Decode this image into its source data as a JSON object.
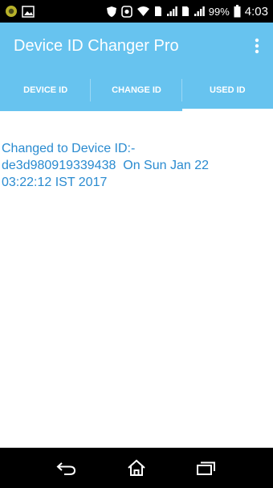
{
  "status_bar": {
    "battery_percent": "99%",
    "time": "4:03",
    "icons_left": [
      "app-icon",
      "gallery-icon"
    ],
    "icons_right": [
      "shield-icon",
      "recorder-icon",
      "wifi-icon",
      "sim-icon",
      "signal-icon",
      "sim-icon",
      "signal-icon",
      "battery-icon"
    ]
  },
  "app_bar": {
    "title": "Device ID Changer Pro",
    "menu_icon": "overflow-menu-icon",
    "background": "#67c3ef"
  },
  "tabs": [
    {
      "label": "DEVICE ID",
      "selected": false
    },
    {
      "label": "CHANGE ID",
      "selected": false
    },
    {
      "label": "USED ID",
      "selected": true
    }
  ],
  "content": {
    "log_entry": "Changed to Device ID:-\nde3d980919339438  On Sun Jan 22\n03:22:12 IST 2017",
    "text_color": "#2a8bd0"
  },
  "nav_bar": {
    "icons": [
      "back-icon",
      "home-icon",
      "recents-icon"
    ]
  }
}
